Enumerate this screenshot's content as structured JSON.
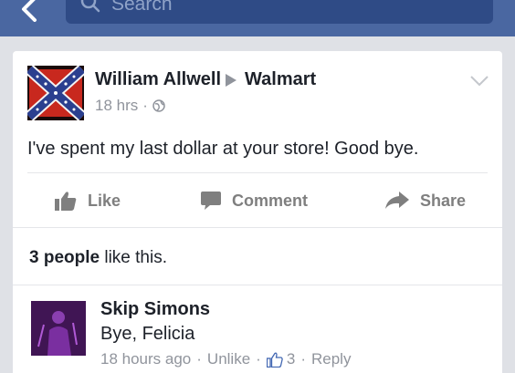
{
  "search": {
    "placeholder": "Search"
  },
  "post": {
    "author": "William Allwell",
    "target": "Walmart",
    "time": "18 hrs",
    "text": "I've spent my last dollar at your store! Good bye."
  },
  "actions": {
    "like": "Like",
    "comment": "Comment",
    "share": "Share"
  },
  "likes": {
    "count_text": "3 people",
    "suffix": " like this."
  },
  "comment": {
    "author": "Skip Simons",
    "text": "Bye, Felicia",
    "time": "18 hours ago",
    "unlike": "Unlike",
    "like_count": "3",
    "reply": "Reply"
  },
  "colors": {
    "navbar": "#4a67a1",
    "search_bg": "#2f4b86",
    "background": "#dfe1e6"
  }
}
